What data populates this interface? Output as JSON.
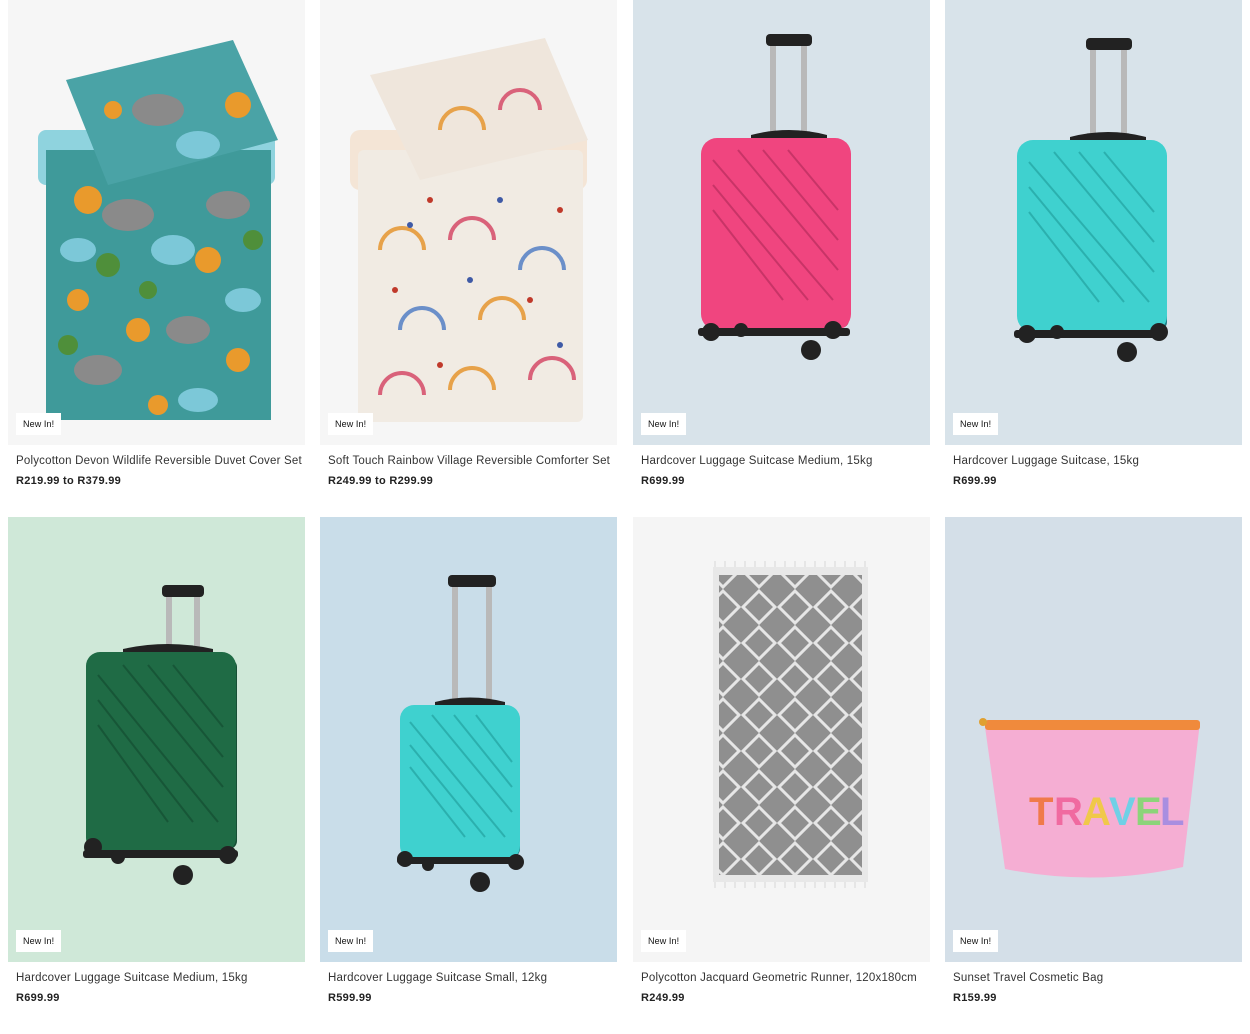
{
  "products": [
    {
      "badge": "New In!",
      "title": "Polycotton Devon Wildlife Reversible Duvet Cover Set",
      "price": "R219.99 to R379.99",
      "image": "duvet-wildlife-teal",
      "bg": "#f6f6f6"
    },
    {
      "badge": "New In!",
      "title": "Soft Touch Rainbow Village Reversible Comforter Set",
      "price": "R249.99 to R299.99",
      "image": "comforter-rainbow-cream",
      "bg": "#f6f6f6"
    },
    {
      "badge": "New In!",
      "title": "Hardcover Luggage Suitcase Medium, 15kg",
      "price": "R699.99",
      "image": "suitcase-pink",
      "color": "#f0457f",
      "bg": "#d8e3ea"
    },
    {
      "badge": "New In!",
      "title": "Hardcover Luggage Suitcase, 15kg",
      "price": "R699.99",
      "image": "suitcase-turquoise",
      "color": "#3fd1cf",
      "bg": "#d8e3ea"
    },
    {
      "badge": "New In!",
      "title": "Hardcover Luggage Suitcase Medium, 15kg",
      "price": "R699.99",
      "image": "suitcase-green",
      "color": "#1f6b45",
      "bg": "#cfe8d8"
    },
    {
      "badge": "New In!",
      "title": "Hardcover Luggage Suitcase Small, 12kg",
      "price": "R599.99",
      "image": "suitcase-turquoise-small",
      "color": "#3fd1cf",
      "bg": "#c9dde9"
    },
    {
      "badge": "New In!",
      "title": "Polycotton Jacquard Geometric Runner, 120x180cm",
      "price": "R249.99",
      "image": "runner-grey-geometric",
      "bg": "#f5f5f5"
    },
    {
      "badge": "New In!",
      "title": "Sunset Travel Cosmetic Bag",
      "price": "R159.99",
      "image": "cosmetic-bag-pink",
      "bg": "#d4dfe8",
      "print_text": "TRAVEL"
    }
  ]
}
